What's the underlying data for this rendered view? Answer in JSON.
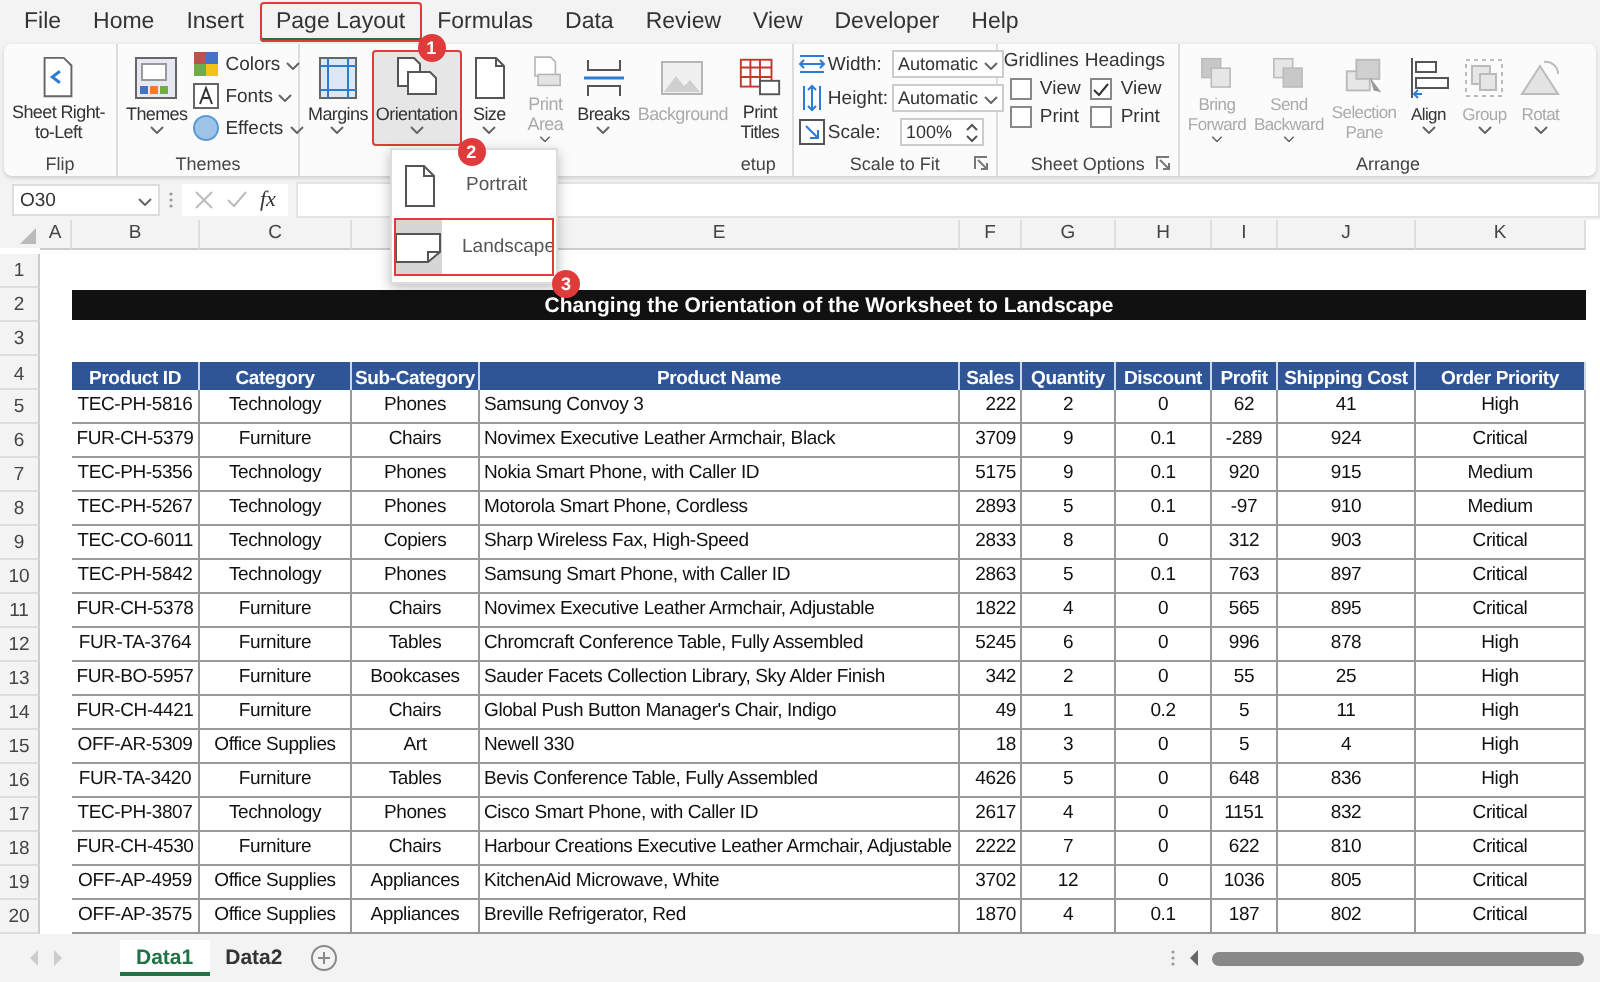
{
  "menu_tabs": [
    {
      "label": "File",
      "selected": false
    },
    {
      "label": "Home",
      "selected": false
    },
    {
      "label": "Insert",
      "selected": false
    },
    {
      "label": "Page Layout",
      "selected": true,
      "callout": "1"
    },
    {
      "label": "Formulas",
      "selected": false
    },
    {
      "label": "Data",
      "selected": false
    },
    {
      "label": "Review",
      "selected": false
    },
    {
      "label": "View",
      "selected": false
    },
    {
      "label": "Developer",
      "selected": false
    },
    {
      "label": "Help",
      "selected": false
    }
  ],
  "ribbon": {
    "groups": [
      {
        "kind": "flip",
        "label": "Flip",
        "buttons": [
          {
            "lines": [
              "Sheet Right-",
              "to-Left"
            ],
            "disabled": false,
            "dropdown": false
          }
        ]
      },
      {
        "kind": "themes",
        "label": "Themes",
        "buttons": [
          {
            "lines": [
              "Themes"
            ],
            "disabled": false,
            "dropdown": true
          }
        ],
        "options": [
          {
            "label": "Colors"
          },
          {
            "label": "Fonts"
          },
          {
            "label": "Effects"
          }
        ]
      },
      {
        "kind": "page_setup",
        "label": "etup",
        "buttons": [
          {
            "lines": [
              "Margins"
            ],
            "disabled": false,
            "dropdown": true
          },
          {
            "lines": [
              "Orientation"
            ],
            "disabled": false,
            "dropdown": true,
            "highlighted": true,
            "callout": "2"
          },
          {
            "lines": [
              "Size"
            ],
            "disabled": false,
            "dropdown": true
          },
          {
            "lines": [
              "Print",
              "Area"
            ],
            "disabled": true,
            "dropdown": true
          },
          {
            "lines": [
              "Breaks"
            ],
            "disabled": false,
            "dropdown": true
          },
          {
            "lines": [
              "Background"
            ],
            "disabled": true,
            "dropdown": false
          },
          {
            "lines": [
              "Print",
              "Titles"
            ],
            "disabled": false,
            "dropdown": false
          }
        ]
      },
      {
        "kind": "scale",
        "label": "Scale to Fit",
        "fields": [
          {
            "label": "Width:",
            "value": "Automatic"
          },
          {
            "label": "Height:",
            "value": "Automatic"
          },
          {
            "label": "Scale:",
            "value": "100%"
          }
        ]
      },
      {
        "kind": "sheet_options",
        "label": "Sheet Options",
        "columns": [
          {
            "title": "Gridlines",
            "options": [
              {
                "label": "View",
                "checked": false
              },
              {
                "label": "Print",
                "checked": false
              }
            ]
          },
          {
            "title": "Headings",
            "options": [
              {
                "label": "View",
                "checked": true
              },
              {
                "label": "Print",
                "checked": false
              }
            ]
          }
        ]
      },
      {
        "kind": "arrange",
        "label": "Arrange",
        "buttons": [
          {
            "lines": [
              "Bring",
              "Forward"
            ],
            "disabled": true,
            "dropdown": true
          },
          {
            "lines": [
              "Send",
              "Backward"
            ],
            "disabled": true,
            "dropdown": true
          },
          {
            "lines": [
              "Selection",
              "Pane"
            ],
            "disabled": true,
            "dropdown": false
          },
          {
            "lines": [
              "Align"
            ],
            "disabled": false,
            "dropdown": true
          },
          {
            "lines": [
              "Group"
            ],
            "disabled": true,
            "dropdown": true
          },
          {
            "lines": [
              "Rotat"
            ],
            "disabled": true,
            "dropdown": true
          }
        ]
      }
    ]
  },
  "orientation_menu": {
    "items": [
      {
        "label": "Portrait",
        "selected": false
      },
      {
        "label": "Landscape",
        "selected": true,
        "callout": "3"
      }
    ]
  },
  "name_box": "O30",
  "function_symbol": "fx",
  "sheet": {
    "columns": [
      {
        "letter": "A"
      },
      {
        "letter": "B"
      },
      {
        "letter": "C"
      },
      {},
      {
        "letter": "E"
      },
      {
        "letter": "F"
      },
      {
        "letter": "G"
      },
      {
        "letter": "H"
      },
      {
        "letter": "I"
      },
      {
        "letter": "J"
      },
      {
        "letter": "K"
      }
    ],
    "row_numbers": [
      "1",
      "2",
      "3",
      "4",
      "5",
      "6",
      "7",
      "8",
      "9",
      "10",
      "11",
      "12",
      "13",
      "14",
      "15",
      "16",
      "17",
      "18",
      "19",
      "20"
    ],
    "title": "Changing the Orientation of the Worksheet to Landscape",
    "header": [
      "Product ID",
      "Category",
      "Sub-Category",
      "Product Name",
      "Sales",
      "Quantity",
      "Discount",
      "Profit",
      "Shipping Cost",
      "Order Priority"
    ],
    "rows": [
      [
        "",
        "TEC-PH-5816",
        "Technology",
        "Phones",
        "Samsung Convoy 3",
        "222",
        "2",
        "0",
        "62",
        "41",
        "High"
      ],
      [
        "",
        "FUR-CH-5379",
        "Furniture",
        "Chairs",
        "Novimex Executive Leather Armchair, Black",
        "3709",
        "9",
        "0.1",
        "-289",
        "924",
        "Critical"
      ],
      [
        "",
        "TEC-PH-5356",
        "Technology",
        "Phones",
        "Nokia Smart Phone, with Caller ID",
        "5175",
        "9",
        "0.1",
        "920",
        "915",
        "Medium"
      ],
      [
        "",
        "TEC-PH-5267",
        "Technology",
        "Phones",
        "Motorola Smart Phone, Cordless",
        "2893",
        "5",
        "0.1",
        "-97",
        "910",
        "Medium"
      ],
      [
        "",
        "TEC-CO-6011",
        "Technology",
        "Copiers",
        "Sharp Wireless Fax, High-Speed",
        "2833",
        "8",
        "0",
        "312",
        "903",
        "Critical"
      ],
      [
        "",
        "TEC-PH-5842",
        "Technology",
        "Phones",
        "Samsung Smart Phone, with Caller ID",
        "2863",
        "5",
        "0.1",
        "763",
        "897",
        "Critical"
      ],
      [
        "",
        "FUR-CH-5378",
        "Furniture",
        "Chairs",
        "Novimex Executive Leather Armchair, Adjustable",
        "1822",
        "4",
        "0",
        "565",
        "895",
        "Critical"
      ],
      [
        "",
        "FUR-TA-3764",
        "Furniture",
        "Tables",
        "Chromcraft Conference Table, Fully Assembled",
        "5245",
        "6",
        "0",
        "996",
        "878",
        "High"
      ],
      [
        "",
        "FUR-BO-5957",
        "Furniture",
        "Bookcases",
        "Sauder Facets Collection Library, Sky Alder Finish",
        "342",
        "2",
        "0",
        "55",
        "25",
        "High"
      ],
      [
        "",
        "FUR-CH-4421",
        "Furniture",
        "Chairs",
        "Global Push Button Manager's Chair, Indigo",
        "49",
        "1",
        "0.2",
        "5",
        "11",
        "High"
      ],
      [
        "",
        "OFF-AR-5309",
        "Office Supplies",
        "Art",
        "Newell 330",
        "18",
        "3",
        "0",
        "5",
        "4",
        "High"
      ],
      [
        "",
        "FUR-TA-3420",
        "Furniture",
        "Tables",
        "Bevis Conference Table, Fully Assembled",
        "4626",
        "5",
        "0",
        "648",
        "836",
        "High"
      ],
      [
        "",
        "TEC-PH-3807",
        "Technology",
        "Phones",
        "Cisco Smart Phone, with Caller ID",
        "2617",
        "4",
        "0",
        "1151",
        "832",
        "Critical"
      ],
      [
        "",
        "FUR-CH-4530",
        "Furniture",
        "Chairs",
        "Harbour Creations Executive Leather Armchair, Adjustable",
        "2222",
        "7",
        "0",
        "622",
        "810",
        "Critical"
      ],
      [
        "",
        "OFF-AP-4959",
        "Office Supplies",
        "Appliances",
        "KitchenAid Microwave, White",
        "3702",
        "12",
        "0",
        "1036",
        "805",
        "Critical"
      ],
      [
        "",
        "OFF-AP-3575",
        "Office Supplies",
        "Appliances",
        "Breville Refrigerator, Red",
        "1870",
        "4",
        "0.1",
        "187",
        "802",
        "Critical"
      ]
    ]
  },
  "sheet_tabs": [
    {
      "label": "Data1",
      "selected": true
    },
    {
      "label": "Data2",
      "selected": false
    }
  ]
}
